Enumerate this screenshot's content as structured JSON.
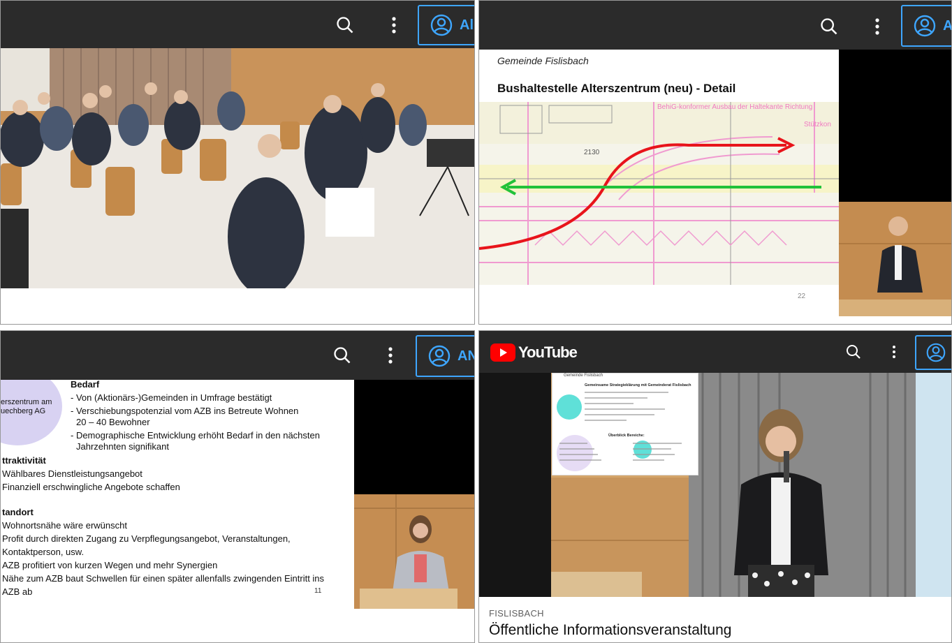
{
  "panels": {
    "p1": {
      "account_label": "Al"
    },
    "p2": {
      "account_label": "A",
      "slide": {
        "org": "Gemeinde Fislisbach",
        "title": "Bushaltestelle Alterszentrum (neu) - Detail",
        "map_label_1": "BehiG-konformer Ausbau der Haltekante Richtung",
        "map_label_2": "Stützkon",
        "map_number": "2130",
        "page_number": "22"
      }
    },
    "p3": {
      "account_label": "AN",
      "circle_text_1": "erszentrum am",
      "circle_text_2": "uechberg AG",
      "heading_bedarf": "Bedarf",
      "bedarf_1": "- Von (Aktionärs-)Gemeinden in Umfrage bestätigt",
      "bedarf_2a": "- Verschiebungspotenzial vom AZB ins Betreute Wohnen",
      "bedarf_2b": "20 – 40 Bewohner",
      "bedarf_3a": "- Demographische Entwicklung erhöht Bedarf in den nächsten",
      "bedarf_3b": "Jahrzehnten signifikant",
      "heading_attr": "ttraktivität",
      "attr_1": "Wählbares Dienstleistungsangebot",
      "attr_2": "Finanziell erschwingliche Angebote schaffen",
      "heading_standort": "tandort",
      "st_1": "Wohnortsnähe wäre erwünscht",
      "st_2": "Profit durch direkten Zugang zu Verpflegungsangebot, Veranstaltungen,",
      "st_3": "Kontaktperson, usw.",
      "st_4": "AZB profitiert von kurzen Wegen und mehr Synergien",
      "st_5": "Nähe zum AZB baut Schwellen für einen später allenfalls zwingenden Eintritt ins",
      "st_6": "AZB ab",
      "page_number": "11"
    },
    "p4": {
      "logo_text": "YouTube",
      "slide_org": "Gemeinde Fislisbach",
      "slide_heading": "Gemeinsame Strategieklärung mit Gemeinderat Fislisbach",
      "slide_sub": "Überblick Bereiche:",
      "channel": "FISLISBACH",
      "video_title": "Öffentliche Informationsveranstaltung"
    }
  },
  "colors": {
    "topbar": "#2b2b2b",
    "accent": "#3ea6ff",
    "youtube_red": "#ff0000",
    "route_red": "#e8141b",
    "route_green": "#22c23a"
  },
  "icons": [
    "search-icon",
    "more-vert-icon",
    "account-circle-icon",
    "youtube-play-icon"
  ]
}
